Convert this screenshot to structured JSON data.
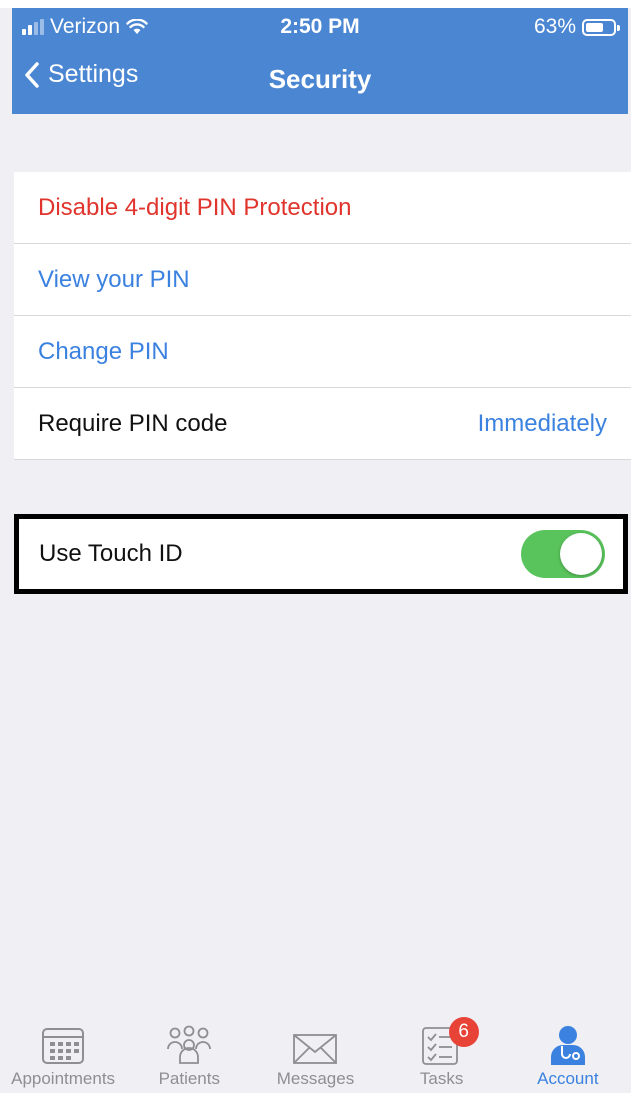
{
  "status": {
    "carrier": "Verizon",
    "time": "2:50 PM",
    "battery": "63%",
    "battery_level": 0.63
  },
  "nav": {
    "back_label": "Settings",
    "title": "Security"
  },
  "pin_section": {
    "disable_label": "Disable 4-digit PIN Protection",
    "view_label": "View your PIN",
    "change_label": "Change PIN",
    "require_label": "Require PIN code",
    "require_value": "Immediately"
  },
  "touch_id": {
    "label": "Use Touch ID",
    "enabled": true
  },
  "tabs": [
    {
      "label": "Appointments",
      "icon": "calendar-icon"
    },
    {
      "label": "Patients",
      "icon": "patients-icon"
    },
    {
      "label": "Messages",
      "icon": "envelope-icon"
    },
    {
      "label": "Tasks",
      "icon": "tasks-icon",
      "badge": "6"
    },
    {
      "label": "Account",
      "icon": "doctor-icon",
      "active": true
    }
  ],
  "colors": {
    "nav_bg": "#4a86d2",
    "accent": "#3b82e0",
    "destructive": "#e0342c",
    "toggle_on": "#5ac45c",
    "badge": "#e84337"
  }
}
